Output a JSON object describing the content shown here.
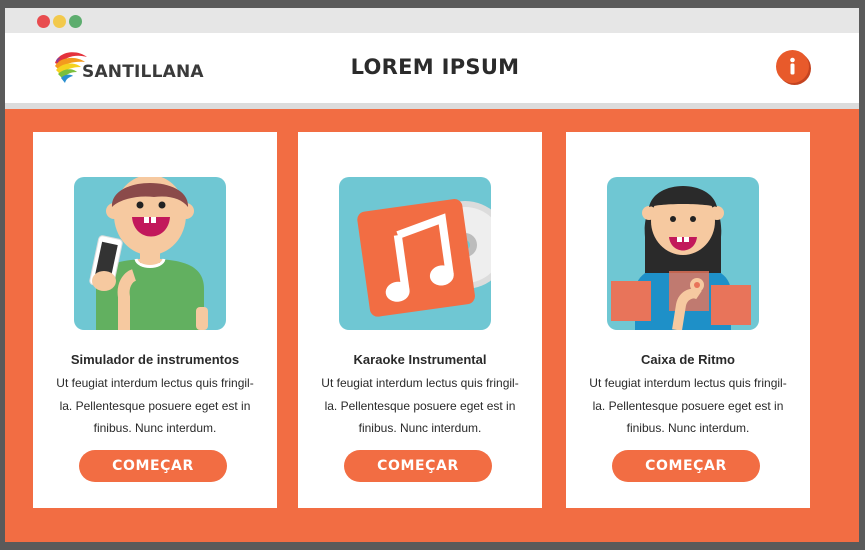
{
  "window": {
    "controls": [
      "close",
      "minimize",
      "maximize"
    ]
  },
  "header": {
    "logo_text": "SANTILLANA",
    "title": "LOREM IPSUM",
    "info_icon": "info-icon"
  },
  "colors": {
    "accent": "#f26d43",
    "header_bg": "#ffffff",
    "card_bg": "#ffffff",
    "illustration_bg": "#6fc7d3",
    "frame": "#5a5a5a"
  },
  "cards": [
    {
      "title": "Simulador de instrumentos",
      "description": "Ut feugiat interdum lectus quis fringil-la. Pellentesque posuere eget est in finibus. Nunc interdum.",
      "button": "COMEÇAR",
      "illustration": "boy-with-phone"
    },
    {
      "title": "Karaoke Instrumental",
      "description": "Ut feugiat interdum lectus quis fringil-la. Pellentesque posuere eget est in finibus. Nunc interdum.",
      "button": "COMEÇAR",
      "illustration": "music-note-cd"
    },
    {
      "title": "Caixa de Ritmo",
      "description": "Ut feugiat interdum lectus quis fringil-la. Pellentesque posuere eget est in finibus. Nunc interdum.",
      "button": "COMEÇAR",
      "illustration": "girl-with-pads"
    }
  ]
}
